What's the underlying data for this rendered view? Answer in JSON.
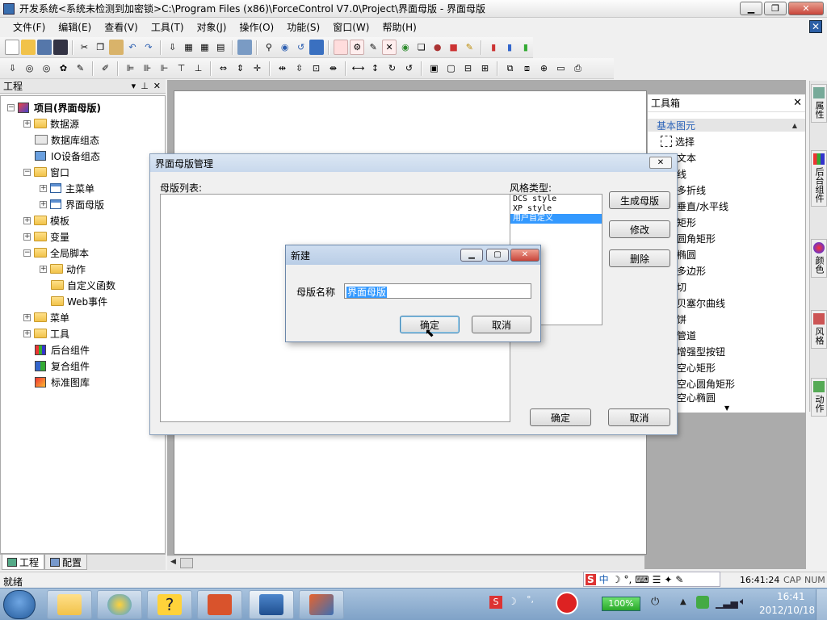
{
  "window": {
    "title": "开发系统<系统未检测到加密锁>C:\\Program Files (x86)\\ForceControl V7.0\\Project\\界面母版 - 界面母版"
  },
  "menu": [
    "文件(F)",
    "编辑(E)",
    "查看(V)",
    "工具(T)",
    "对象(J)",
    "操作(O)",
    "功能(S)",
    "窗口(W)",
    "帮助(H)"
  ],
  "project_panel": {
    "title": "工程",
    "tree": [
      {
        "label": "项目(界面母版)",
        "level": 0,
        "icon": "project-icon",
        "expander": "-"
      },
      {
        "label": "数据源",
        "level": 1,
        "icon": "folder-icon",
        "expander": "+"
      },
      {
        "label": "数据库组态",
        "level": 1,
        "icon": "database-icon",
        "expander": ""
      },
      {
        "label": "IO设备组态",
        "level": 1,
        "icon": "network-icon",
        "expander": ""
      },
      {
        "label": "窗口",
        "level": 1,
        "icon": "folder-open-icon",
        "expander": "-"
      },
      {
        "label": "主菜单",
        "level": 2,
        "icon": "window-icon",
        "expander": "+"
      },
      {
        "label": "界面母版",
        "level": 2,
        "icon": "window-icon",
        "expander": "+"
      },
      {
        "label": "模板",
        "level": 1,
        "icon": "folder-icon",
        "expander": "+"
      },
      {
        "label": "变量",
        "level": 1,
        "icon": "folder-icon",
        "expander": "+"
      },
      {
        "label": "全局脚本",
        "level": 1,
        "icon": "folder-open-icon",
        "expander": "-"
      },
      {
        "label": "动作",
        "level": 2,
        "icon": "folder-icon",
        "expander": "+"
      },
      {
        "label": "自定义函数",
        "level": 2,
        "icon": "folder-icon",
        "expander": ""
      },
      {
        "label": "Web事件",
        "level": 2,
        "icon": "folder-icon",
        "expander": ""
      },
      {
        "label": "菜单",
        "level": 1,
        "icon": "folder-icon",
        "expander": "+"
      },
      {
        "label": "工具",
        "level": 1,
        "icon": "folder-icon",
        "expander": "+"
      },
      {
        "label": "后台组件",
        "level": 1,
        "icon": "bg-component-icon",
        "expander": ""
      },
      {
        "label": "复合组件",
        "level": 1,
        "icon": "composite-component-icon",
        "expander": ""
      },
      {
        "label": "标准图库",
        "level": 1,
        "icon": "library-icon",
        "expander": ""
      }
    ],
    "tabs": [
      "工程",
      "配置"
    ]
  },
  "toolbox": {
    "title": "工具箱",
    "section": "基本图元",
    "items": [
      "选择",
      "文本",
      "线",
      "多折线",
      "垂直/水平线",
      "矩形",
      "圆角矩形",
      "椭圆",
      "多边形",
      "切",
      "贝塞尔曲线",
      "饼",
      "管道",
      "增强型按钮",
      "空心矩形",
      "空心圆角矩形",
      "空心椭圆"
    ]
  },
  "right_tabs": [
    "属性",
    "后台组件",
    "颜色",
    "风格",
    "动作"
  ],
  "master_dialog": {
    "title": "界面母版管理",
    "list_label": "母版列表:",
    "style_label": "风格类型:",
    "styles": [
      "DCS style",
      "XP style",
      "用户自定义"
    ],
    "selected_style_index": 2,
    "buttons": {
      "generate": "生成母版",
      "modify": "修改",
      "delete": "删除",
      "ok": "确定",
      "cancel": "取消"
    }
  },
  "new_dialog": {
    "title": "新建",
    "label": "母版名称",
    "value": "界面母版",
    "ok": "确定",
    "cancel": "取消"
  },
  "statusbar": {
    "text": "就绪",
    "time": "16:41:24",
    "cap": "CAP",
    "num": "NUM"
  },
  "taskbar": {
    "zoom": "100%",
    "clock_time": "16:41",
    "clock_date": "2012/10/18"
  },
  "colors": {
    "accent": "#3399ff",
    "title_gradient": "#c8d8ec",
    "toolbox_section": "#2b63b8"
  }
}
